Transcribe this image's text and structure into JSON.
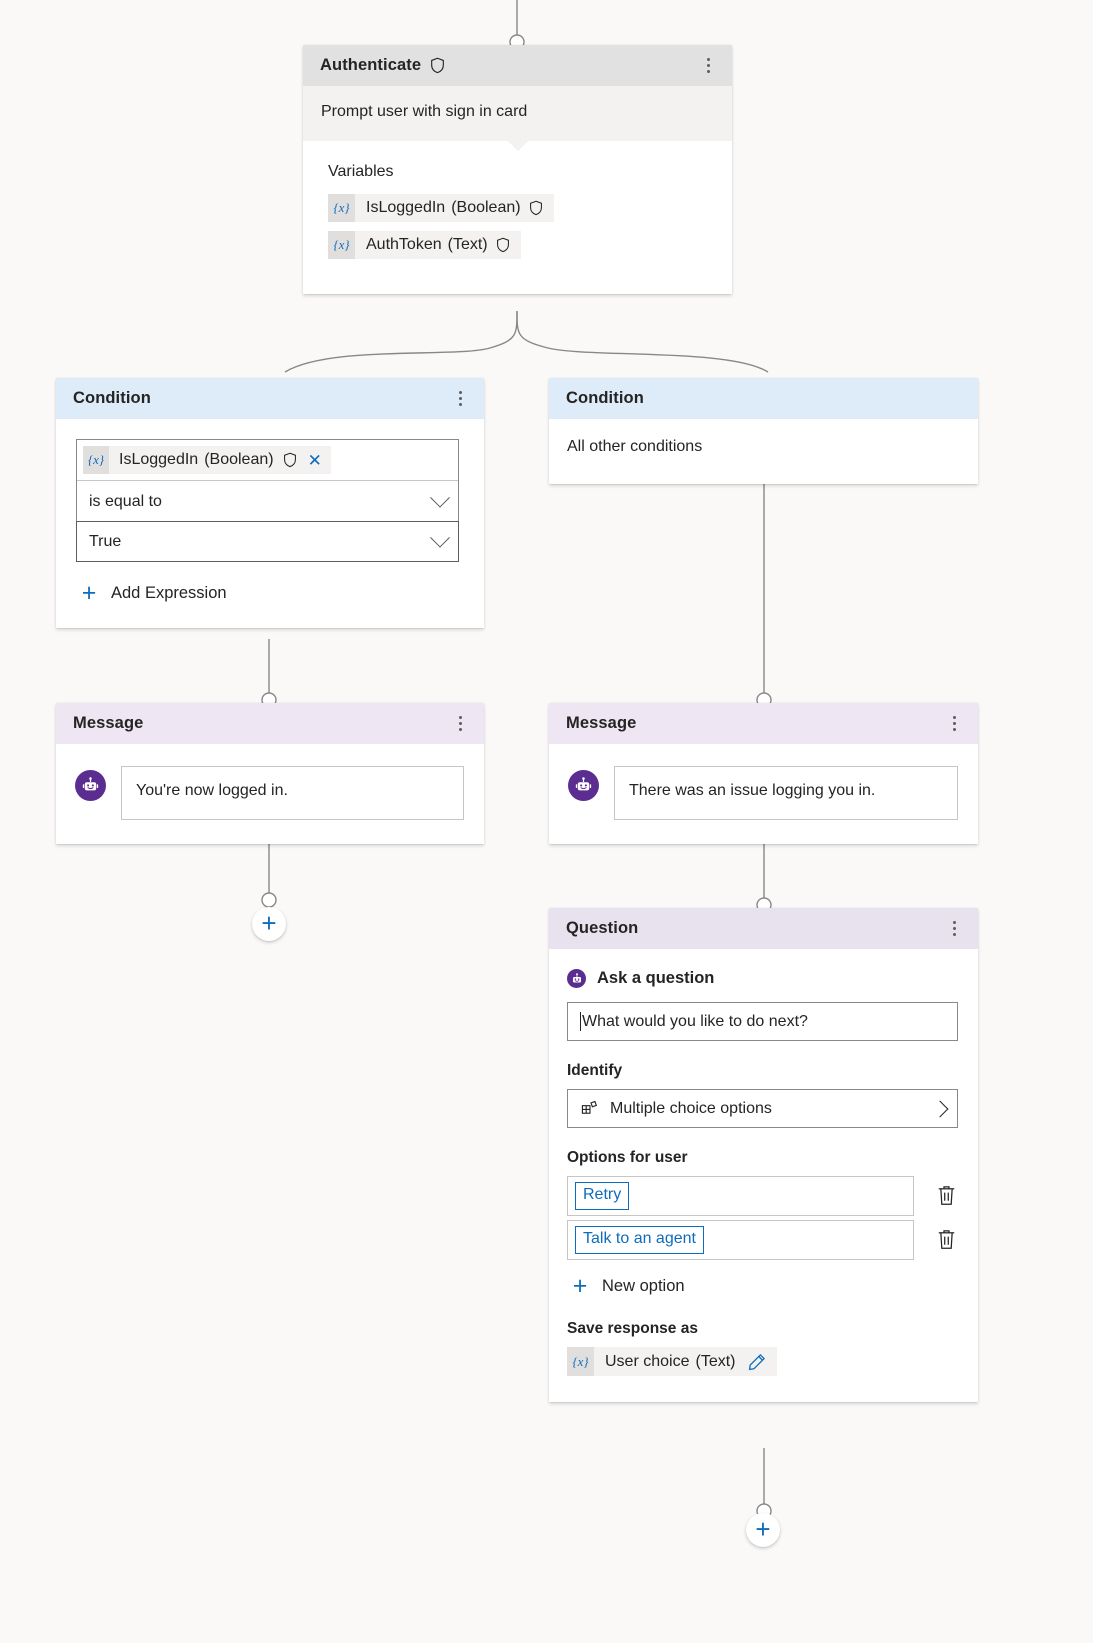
{
  "theme": {
    "canvas_bg": "#faf9f8",
    "accent_blue": "#0f6cbd",
    "bot_purple": "#5c2d91",
    "authenticate_header_bg": "#e1e1e1",
    "condition_header_bg": "#deecf9",
    "message_header_bg": "#eee6f3",
    "question_header_bg": "#e8e1ee"
  },
  "nodes": {
    "authenticate": {
      "title": "Authenticate",
      "shield_icon": "shield-icon",
      "menu_icon": "more-options-icon",
      "subtitle": "Prompt user with sign in card",
      "variables_label": "Variables",
      "variables": [
        {
          "badge": "{x}",
          "name": "IsLoggedIn",
          "type": "(Boolean)",
          "shield_icon": "shield-icon"
        },
        {
          "badge": "{x}",
          "name": "AuthToken",
          "type": "(Text)",
          "shield_icon": "shield-icon"
        }
      ]
    },
    "condition_left": {
      "title": "Condition",
      "menu_icon": "more-options-icon",
      "expression": {
        "variable_badge": "{x}",
        "variable_name": "IsLoggedIn",
        "variable_type": "(Boolean)",
        "shield_icon": "shield-icon",
        "clear_icon": "✕",
        "operator": "is equal to",
        "value": "True"
      },
      "add_expression_label": "Add Expression",
      "add_icon": "plus-icon"
    },
    "condition_right": {
      "title": "Condition",
      "body_text": "All other conditions"
    },
    "message_left": {
      "title": "Message",
      "menu_icon": "more-options-icon",
      "avatar_icon": "bot-avatar-icon",
      "text": "You're now logged in."
    },
    "message_right": {
      "title": "Message",
      "menu_icon": "more-options-icon",
      "avatar_icon": "bot-avatar-icon",
      "text": "There was an issue logging you in."
    },
    "question": {
      "title": "Question",
      "menu_icon": "more-options-icon",
      "ask_icon": "bot-dot-icon",
      "ask_label": "Ask a question",
      "question_text": "What would you like to do next?",
      "identify_label": "Identify",
      "identify_value": "Multiple choice options",
      "identify_icon": "multiple-choice-icon",
      "identify_chevron": "chevron-right-icon",
      "options_label": "Options for user",
      "options": [
        {
          "value": "Retry",
          "delete_icon": "trash-icon"
        },
        {
          "value": "Talk to an agent",
          "delete_icon": "trash-icon"
        }
      ],
      "new_option_label": "New option",
      "new_option_icon": "plus-icon",
      "save_response_label": "Save response as",
      "save_response_variable": {
        "badge": "{x}",
        "name": "User choice",
        "type": "(Text)",
        "edit_icon": "pencil-icon"
      }
    }
  },
  "canvas": {
    "add_node_left": {
      "label": "+",
      "icon": "plus-icon"
    },
    "add_node_right": {
      "label": "+",
      "icon": "plus-icon"
    }
  }
}
